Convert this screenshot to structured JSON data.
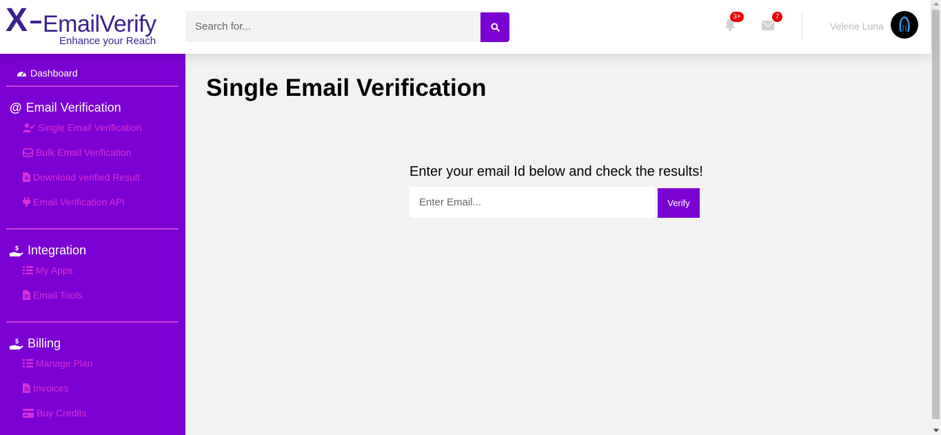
{
  "header": {
    "logo": {
      "mark": "X",
      "name": "EmailVerify",
      "tagline": "Enhance your Reach"
    },
    "search": {
      "placeholder": "Search for...",
      "button_icon": "search-icon"
    },
    "notifications": {
      "icon": "bell-icon",
      "badge": "3+"
    },
    "messages": {
      "icon": "envelope-icon",
      "badge": "7"
    },
    "user": {
      "name": "Velerie Luna",
      "avatar": "avatar"
    }
  },
  "sidebar": {
    "dashboard": {
      "label": "Dashboard",
      "icon": "gauge-icon"
    },
    "sections": [
      {
        "heading": "Email Verification",
        "icon": "at-icon",
        "items": [
          {
            "label": "Single Email Verification",
            "icon": "user-check-icon"
          },
          {
            "label": "Bulk Email Verification",
            "icon": "inbox-icon"
          },
          {
            "label": "Download verified Result",
            "icon": "file-download-icon"
          },
          {
            "label": "Email Verification API",
            "icon": "plug-icon"
          }
        ]
      },
      {
        "heading": "Integration",
        "icon": "hand-dollar-icon",
        "items": [
          {
            "label": "My Apps",
            "icon": "list-icon"
          },
          {
            "label": "Email Tools",
            "icon": "file-icon"
          }
        ]
      },
      {
        "heading": "Billing",
        "icon": "hand-dollar-icon",
        "items": [
          {
            "label": "Manage Plan",
            "icon": "list-icon"
          },
          {
            "label": "Invoices",
            "icon": "file-icon"
          },
          {
            "label": "Buy Credits",
            "icon": "credit-card-icon"
          }
        ]
      }
    ]
  },
  "main": {
    "title": "Single Email Verification",
    "prompt": "Enter your email Id below and check the results!",
    "email_placeholder": "Enter Email...",
    "verify_label": "Verify"
  },
  "colors": {
    "primary": "#7b00d4",
    "sidebar_link": "#d531d7",
    "sidebar_rule": "#d33ddf",
    "badge": "#e60000",
    "logo": "#3a1f8c",
    "page_bg": "#f3f2f3"
  }
}
